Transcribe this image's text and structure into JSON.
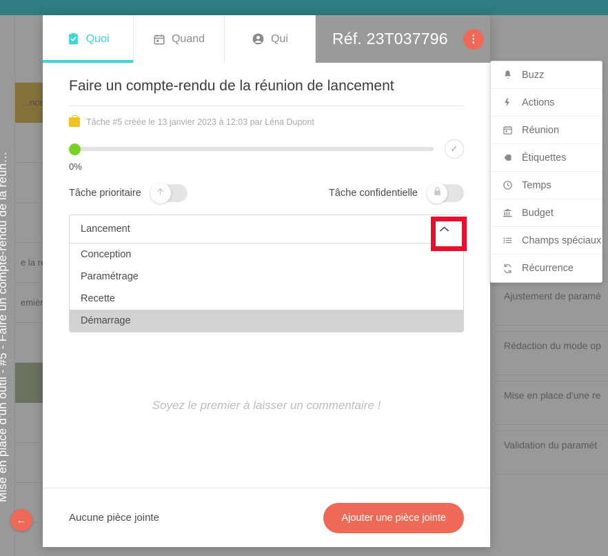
{
  "background": {
    "rows": [
      {
        "label": "",
        "style": "plain"
      },
      {
        "label": "…ncement",
        "style": "gold"
      },
      {
        "label": "",
        "style": "plain"
      },
      {
        "label": "",
        "style": "plain"
      },
      {
        "label": "",
        "style": "plain"
      },
      {
        "label": "e la réunion",
        "style": "plain"
      },
      {
        "label": "emière réu",
        "style": "plain"
      },
      {
        "label": "",
        "style": "plain"
      },
      {
        "label": "",
        "style": "olive"
      },
      {
        "label": "",
        "style": "plain"
      },
      {
        "label": "",
        "style": "plain"
      },
      {
        "label": "",
        "style": "plain"
      }
    ],
    "cards": [
      "Ajustement de paramè",
      "Rédaction du mode op",
      "Mise en place d'une re",
      "Validation du paramét"
    ]
  },
  "vertical_rail": {
    "breadcrumb": "Mise en place d'un outil - #5 - Faire un compte-rendu de la réun…",
    "back_icon": "←"
  },
  "header": {
    "tabs": [
      {
        "label": "Quoi",
        "icon": "clipboard-check-icon",
        "active": true
      },
      {
        "label": "Quand",
        "icon": "calendar-icon",
        "active": false
      },
      {
        "label": "Qui",
        "icon": "user-circle-icon",
        "active": false
      }
    ],
    "reference": "Réf. 23T037796",
    "more_icon": "⋮",
    "accent_color": "#3dd5d5",
    "action_color": "#ef6a56"
  },
  "task": {
    "title": "Faire un compte-rendu de la réunion de lancement",
    "meta": "Tâche #5 créée le 13 janvier 2023 à 12:03 par Léna Dupont",
    "progress_percent": "0%",
    "progress_value": 0,
    "check_icon": "✓",
    "priority": {
      "label": "Tâche prioritaire",
      "icon": "arrow-up-icon",
      "on": false
    },
    "confidential": {
      "label": "Tâche confidentielle",
      "icon": "lock-icon",
      "on": false
    }
  },
  "dropdown": {
    "selected": "Lancement",
    "arrow_icon": "chevron-up-icon",
    "expanded": true,
    "highlight_color": "#e8112d",
    "options": [
      {
        "label": "Conception",
        "highlighted": false
      },
      {
        "label": "Paramétrage",
        "highlighted": false
      },
      {
        "label": "Recette",
        "highlighted": false
      },
      {
        "label": "Démarrage",
        "highlighted": true
      }
    ]
  },
  "comments": {
    "empty_message": "Soyez le premier à laisser un commentaire !"
  },
  "footer": {
    "attachment_status": "Aucune pièce jointe",
    "add_attachment_label": "Ajouter une pièce jointe"
  },
  "context_menu": {
    "items": [
      {
        "label": "Buzz",
        "icon": "bell-icon"
      },
      {
        "label": "Actions",
        "icon": "lightning-icon"
      },
      {
        "label": "Réunion",
        "icon": "calendar-icon"
      },
      {
        "label": "Étiquettes",
        "icon": "tag-icon"
      },
      {
        "label": "Temps",
        "icon": "clock-icon"
      },
      {
        "label": "Budget",
        "icon": "bank-icon"
      },
      {
        "label": "Champs spéciaux",
        "icon": "list-icon"
      },
      {
        "label": "Récurrence",
        "icon": "refresh-icon"
      }
    ]
  }
}
